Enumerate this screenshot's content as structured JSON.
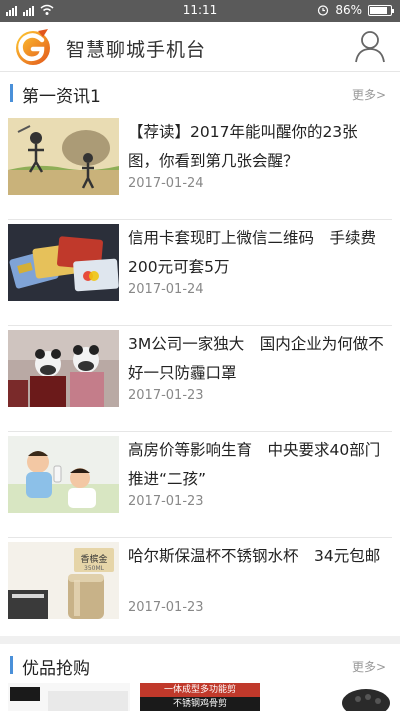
{
  "statusbar": {
    "time": "11:11",
    "battery_text": "86%",
    "battery_level": 0.86
  },
  "header": {
    "title": "智慧聊城手机台"
  },
  "section1": {
    "title": "第一资讯1",
    "more": "更多>"
  },
  "news": [
    {
      "title": "【荐读】2017年能叫醒你的23张图，你看到第几张会醒？",
      "date": "2017-01-24"
    },
    {
      "title": "信用卡套现盯上微信二维码　手续费200元可套5万",
      "date": "2017-01-24"
    },
    {
      "title": "3M公司一家独大　国内企业为何做不好一只防霾口罩",
      "date": "2017-01-23"
    },
    {
      "title": "高房价等影响生育　中央要求40部门推进“二孩”",
      "date": "2017-01-23"
    },
    {
      "title": "哈尔斯保温杯不锈钢水杯　34元包邮",
      "date": "2017-01-23"
    }
  ],
  "section2": {
    "title": "优品抢购",
    "more": "更多>"
  },
  "shop_thumbs": [
    {
      "banner_text": "一体成型多功能剪"
    },
    {
      "banner_text": "不锈钢鸡骨剪"
    }
  ],
  "thumb_labels": {
    "cup_brand": "香槟金",
    "cup_volume": "350ML"
  },
  "colors": {
    "accent_blue": "#4a90d9",
    "logo_orange": "#f39c12"
  }
}
